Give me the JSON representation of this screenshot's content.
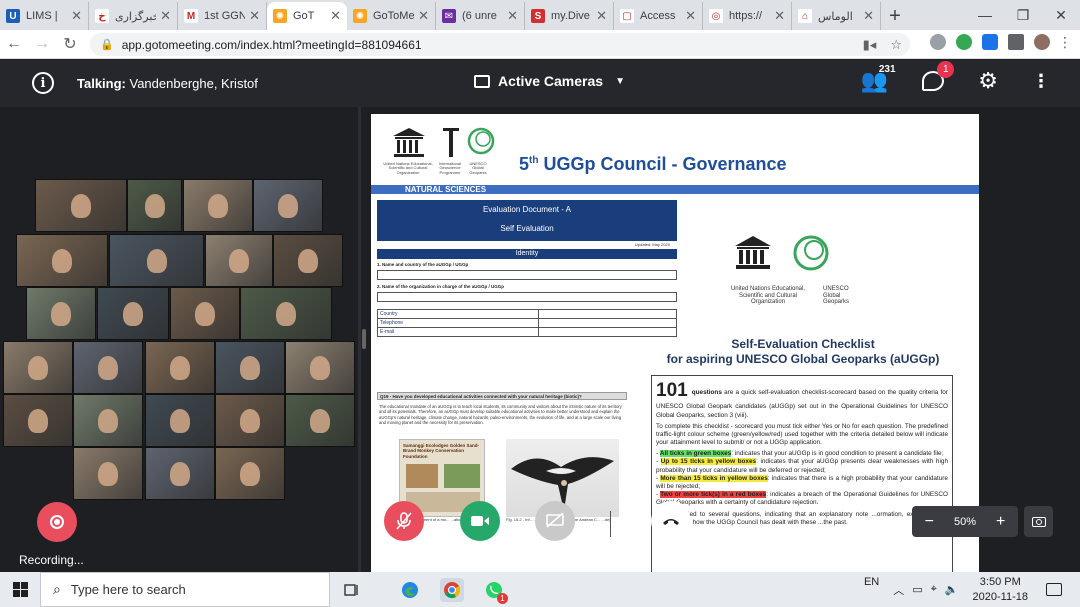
{
  "browser": {
    "tabs": [
      {
        "title": "LIMS | ",
        "favicon_color": "#1a5fb4",
        "favicon_text": "U"
      },
      {
        "title": "خبرگزاری",
        "favicon_color": "#ffffff",
        "favicon_text": "خ"
      },
      {
        "title": "1st GGN",
        "favicon_color": "#ffffff",
        "favicon_text": "M"
      },
      {
        "title": "GoT",
        "favicon_color": "#f6a623",
        "favicon_text": "✺",
        "active": true
      },
      {
        "title": "GoToMe",
        "favicon_color": "#f6a623",
        "favicon_text": "✺"
      },
      {
        "title": "(6 unre",
        "favicon_color": "#6b2e9e",
        "favicon_text": "✉"
      },
      {
        "title": "my.Dive",
        "favicon_color": "#d32f2f",
        "favicon_text": "S"
      },
      {
        "title": "Access",
        "favicon_color": "#ffffff",
        "favicon_text": "▢"
      },
      {
        "title": "https://",
        "favicon_color": "#ffffff",
        "favicon_text": "◎"
      },
      {
        "title": "الوماس",
        "favicon_color": "#ffffff",
        "favicon_text": "⌂"
      }
    ],
    "new_tab": "+",
    "url": "app.gotomeeting.com/index.html?meetingId=881094661"
  },
  "meeting": {
    "talking_label": "Talking:",
    "talking_name": "Vandenberghe, Kristof",
    "cameras_label": "Active Cameras",
    "attendee_count": "231",
    "chat_badge": "1",
    "zoom_level": "50%"
  },
  "document": {
    "org_small_1": "United Nations Educational, Scientific and Cultural Organization",
    "org_small_2": "International Geoscience Programme",
    "org_small_3": "UNESCO Global Geoparks",
    "title_num": "5",
    "title_sup": "th",
    "title_rest": " UGGp Council - Governance",
    "natural_sciences": "NATURAL SCIENCES",
    "eval_line1": "Evaluation Document - A",
    "eval_line2": "Self Evaluation",
    "updated": "Updated: May 2020",
    "identity": "Identity",
    "q1": "1. Name and country of the aUGGp / UGGp",
    "q2": "2. Name of the organization in charge of the aUGGp / UGGp",
    "table_rows": [
      "Country",
      "Telephone",
      "E-mail"
    ],
    "q19": "Q19 - Have you developed educational activities connected with your natural heritage (biotic)?",
    "q19_text": "The educational mandate of an aUGGp is to teach local students, its community and visitors about the intrinsic nature of its territory and all its potentials. Therefore, an aUGGp must develop suitable educational activities to make better understood and explain the aUGGp's natural heritage, climate change, natural hazards, paleo-environments, the evolution of life, and at a large scale our living and moving planet and the necessity for its preservation.",
    "brochure_title": "Samanggi Ecolodges Golden Sand-Brand Monkey Conservation Foundation",
    "fig1_caption": "Fig. 1: ...blishment of a mo... ...ation, Shennong...",
    "fig2_caption": "Fig. 15.2 - Inf... ...reservation plan for the Andean C... ...de)",
    "unesco_right_1": "United Nations Educational, Scientific and Cultural Organization",
    "unesco_right_2": "UNESCO Global Geoparks",
    "checklist_title_1": "Self-Evaluation Checklist",
    "checklist_title_2": "for aspiring UNESCO Global Geoparks (aUGGp)",
    "big_number": "101",
    "intro_questions": "questions",
    "intro_rest": " are a quick self-evaluation checklist-scorecard based on the quality criteria for UNESCO Global Geopark candidates (aUGGp) set out in the Operational Guidelines for UNESCO Global Geoparks, section 3 (viii).",
    "para2": "To complete this checklist - scorecard you must tick either Yes or No for each question. The predefined traffic-light colour scheme (green/yellow/red) used together with the criteria detailed below will indicate your attainment level to submit/ or not a UGGp application.",
    "bullet1_hl": "All ticks in green boxes",
    "bullet1_rest": ": indicates that your aUGGp is in good condition to present a candidate file;",
    "bullet2_hl": "Up to 15 ticks in yellow boxes",
    "bullet2_rest": ": indicates that your aUGGp presents clear weaknesses with high probability that your candidature will be deferred or rejected;",
    "bullet3_hl": "More than 15 ticks in yellow boxes",
    "bullet3_rest": ": indicates that there is a high probability that your candidature will be rejected;",
    "bullet4_hl": "Two or more tick(s) in a red boxes",
    "bullet4_rest": ": indicates a breach of the Operational Guidelines for UNESCO Global Geoparks with a certainty of candidature rejection.",
    "para_last": "...been added to several questions, indicating that an explanatory note ...ormation, examples and guidance on how the UGGp Council has dealt with these ...the past."
  },
  "controls": {
    "recording": "Recording...",
    "mic": "Mic",
    "camera": "Camera",
    "screen": "Screen",
    "leave": "Leave"
  },
  "taskbar": {
    "search_placeholder": "Type here to search",
    "language": "EN",
    "time": "3:50 PM",
    "date": "2020-11-18",
    "whatsapp_badge": "1"
  },
  "colors": {
    "header_bg": "#25272c",
    "record_red": "#e84e5d",
    "camera_green": "#27a86b",
    "doc_blue": "#1f4e9c"
  }
}
